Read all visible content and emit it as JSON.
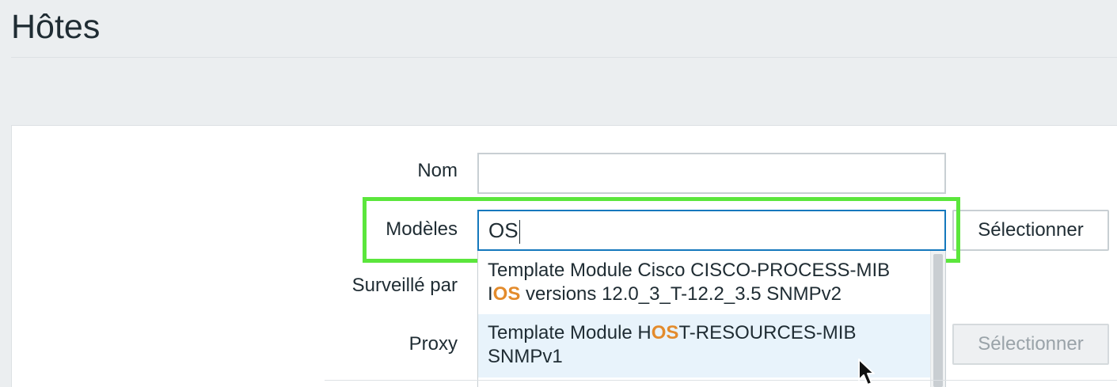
{
  "page": {
    "title": "Hôtes"
  },
  "form": {
    "name_label": "Nom",
    "name_value": "",
    "templates_label": "Modèles",
    "templates_value": "OS",
    "select_button_label": "Sélectionner",
    "monitored_by_label": "Surveillé par",
    "proxy_label": "Proxy",
    "proxy_select_button_label": "Sélectionner"
  },
  "dropdown": {
    "options": [
      {
        "before": "Template Module Cisco CISCO-PROCESS-MIB I",
        "match": "OS",
        "after": " versions 12.0_3_T-12.2_3.5 SNMPv2"
      },
      {
        "before": "Template Module H",
        "match": "OS",
        "after": "T-RESOURCES-MIB SNMPv1"
      }
    ]
  },
  "colors": {
    "highlight_box": "#5be63c",
    "match_text": "#e38b2c",
    "active_input_border": "#1478bd",
    "hovered_option_bg": "#e8f3fb"
  },
  "icons": {
    "cursor": "mouse-pointer-icon"
  }
}
